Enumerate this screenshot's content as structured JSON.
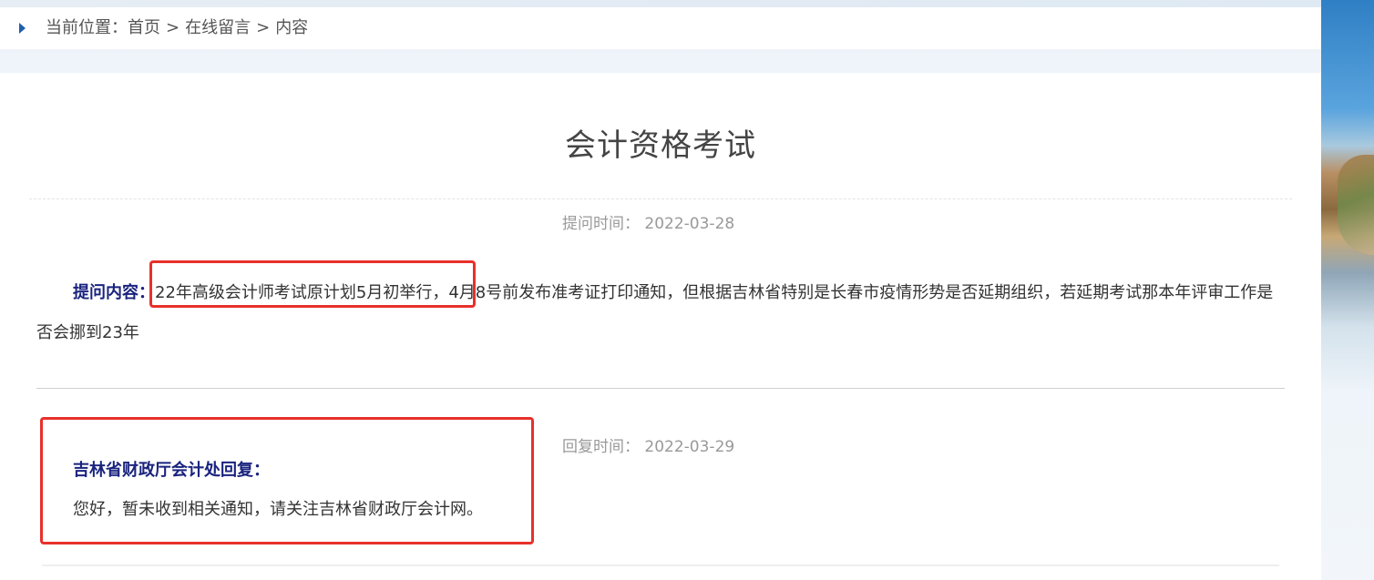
{
  "breadcrumb": {
    "prefix": "当前位置：",
    "items": [
      "首页",
      "在线留言",
      "内容"
    ],
    "separator": ">"
  },
  "article": {
    "title": "会计资格考试",
    "ask_time_label": "提问时间：",
    "ask_time": "2022-03-28",
    "ask_label": "提问内容：",
    "ask_highlight": "22年高级会计师考试原计划5月初举行",
    "ask_rest": "，4月8号前发布准考证打印通知，但根据吉林省特别是长春市疫情形势是否延期组织，若延期考试那本年评审工作是否会挪到23年",
    "reply_time_label": "回复时间：",
    "reply_time": "2022-03-29",
    "reply_label": "吉林省财政厅会计处回复：",
    "reply_text": "您好，暂未收到相关通知，请关注吉林省财政厅会计网。"
  },
  "colors": {
    "label_navy": "#1a237e",
    "highlight_red": "#e8302a",
    "breadcrumb_arrow": "#1f5fae"
  }
}
